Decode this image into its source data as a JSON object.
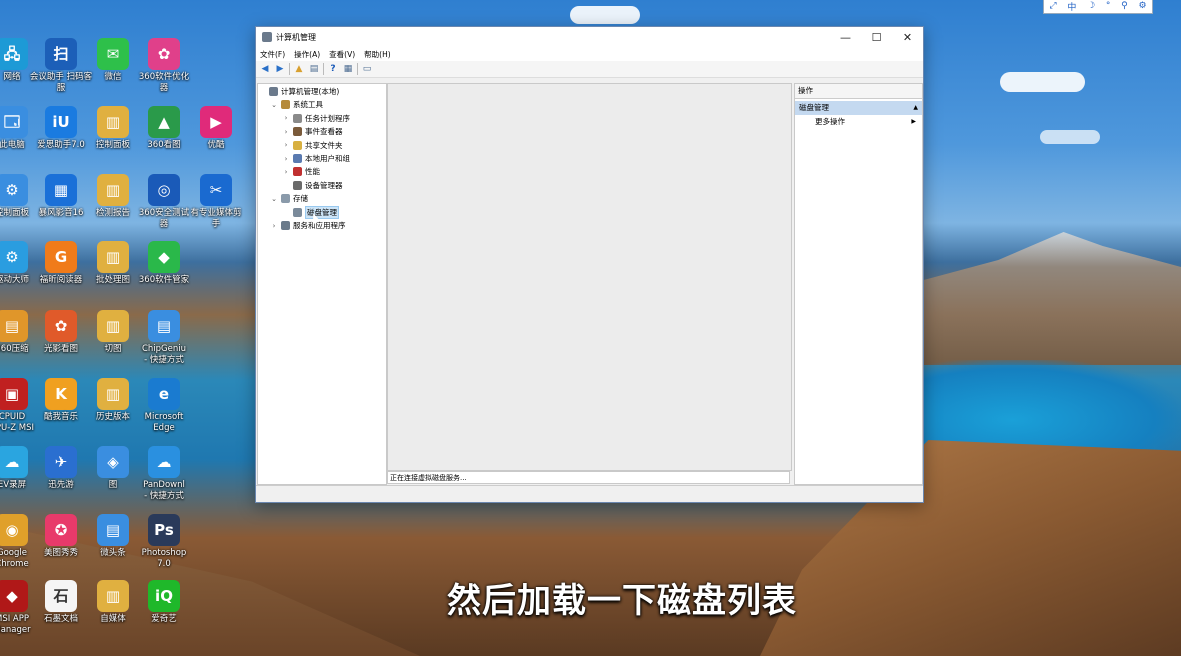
{
  "desktop": {
    "icons": [
      {
        "label": "网络",
        "color": "#1d9ad6",
        "glyph": "🖧"
      },
      {
        "label": "此电脑",
        "color": "#3a8ee0",
        "glyph": "🗔"
      },
      {
        "label": "控制面板",
        "color": "#3a8ee0",
        "glyph": "⚙"
      },
      {
        "label": "驱动大师",
        "color": "#2a9de0",
        "glyph": "⚙"
      },
      {
        "label": "360压缩",
        "color": "#e0962a",
        "glyph": "▤"
      },
      {
        "label": "CPUID\nCPU-Z MSI",
        "color": "#c02020",
        "glyph": "▣"
      },
      {
        "label": "EV录屏",
        "color": "#2aa5e0",
        "glyph": "☁"
      },
      {
        "label": "Google\nChrome",
        "color": "#e0a02a",
        "glyph": "◉"
      },
      {
        "label": "MSI APP\nManager",
        "color": "#b01818",
        "glyph": "◆"
      },
      {
        "label": "会议助手 扫码客\n服",
        "color": "#1c5fb8",
        "glyph": "扫"
      },
      {
        "label": "爱思助手7.0",
        "color": "#1a7be0",
        "glyph": "iU"
      },
      {
        "label": "暴风影音16",
        "color": "#1a70d8",
        "glyph": "▦"
      },
      {
        "label": "福昕阅读器",
        "color": "#f07b1a",
        "glyph": "G"
      },
      {
        "label": "光影看图",
        "color": "#e05a2a",
        "glyph": "✿"
      },
      {
        "label": "酷我音乐",
        "color": "#f0a020",
        "glyph": "K"
      },
      {
        "label": "迅先游",
        "color": "#2a6fd0",
        "glyph": "✈"
      },
      {
        "label": "美图秀秀",
        "color": "#e83a6a",
        "glyph": "✪"
      },
      {
        "label": "石墨文档",
        "color": "#f5f5f5",
        "glyph": "石"
      },
      {
        "label": "微信",
        "color": "#2ec04a",
        "glyph": "✉"
      },
      {
        "label": "控制面板",
        "color": "#e0b040",
        "glyph": "▥"
      },
      {
        "label": "检测报告",
        "color": "#e0b040",
        "glyph": "▥"
      },
      {
        "label": "批处理图",
        "color": "#e0b040",
        "glyph": "▥"
      },
      {
        "label": "切图",
        "color": "#e0b040",
        "glyph": "▥"
      },
      {
        "label": "历史版本",
        "color": "#e0b040",
        "glyph": "▥"
      },
      {
        "label": "图",
        "color": "#3a8ee0",
        "glyph": "◈"
      },
      {
        "label": "微头条",
        "color": "#3a8ee0",
        "glyph": "▤"
      },
      {
        "label": "自媒体",
        "color": "#e0b040",
        "glyph": "▥"
      },
      {
        "label": "360软件优化\n器",
        "color": "#e0408a",
        "glyph": "✿"
      },
      {
        "label": "360看图",
        "color": "#2a9a4a",
        "glyph": "▲"
      },
      {
        "label": "360安全测试\n器",
        "color": "#1a5ab8",
        "glyph": "◎"
      },
      {
        "label": "360软件管家",
        "color": "#2ab84a",
        "glyph": "◆"
      },
      {
        "label": "ChipGeniu\n- 快捷方式",
        "color": "#3a8ee0",
        "glyph": "▤"
      },
      {
        "label": "Microsoft\nEdge",
        "color": "#1a7bd0",
        "glyph": "e"
      },
      {
        "label": "PanDownl\n- 快捷方式",
        "color": "#2a90e0",
        "glyph": "☁"
      },
      {
        "label": "Photoshop\n7.0",
        "color": "#2a3a5a",
        "glyph": "Ps"
      },
      {
        "label": "爱奇艺",
        "color": "#1fb82a",
        "glyph": "iQ"
      },
      {
        "label": "优酷",
        "color": "#e02a7a",
        "glyph": "▶"
      },
      {
        "label": "有专业媒体剪\n手",
        "color": "#1a6ad0",
        "glyph": "✂"
      }
    ]
  },
  "tray": {
    "items": [
      "⤢",
      "中",
      "☽",
      "°",
      "⚲",
      "⚙"
    ]
  },
  "window": {
    "title": "计算机管理",
    "menu": [
      "文件(F)",
      "操作(A)",
      "查看(V)",
      "帮助(H)"
    ],
    "toolbar_icons": [
      "back-icon",
      "forward-icon",
      "up-folder-icon",
      "show-hide-tree-icon",
      "help-icon",
      "properties-icon",
      "console-icon"
    ],
    "tree": [
      {
        "label": "计算机管理(本地)",
        "level": 0,
        "expander": "",
        "color": "#6b7a8c"
      },
      {
        "label": "系统工具",
        "level": 1,
        "expander": "⌄",
        "color": "#b58a3a"
      },
      {
        "label": "任务计划程序",
        "level": 2,
        "expander": "›",
        "color": "#8a8a8a"
      },
      {
        "label": "事件查看器",
        "level": 2,
        "expander": "›",
        "color": "#7a5a3a"
      },
      {
        "label": "共享文件夹",
        "level": 2,
        "expander": "›",
        "color": "#d8b040"
      },
      {
        "label": "本地用户和组",
        "level": 2,
        "expander": "›",
        "color": "#5a7ab0"
      },
      {
        "label": "性能",
        "level": 2,
        "expander": "›",
        "color": "#c03030"
      },
      {
        "label": "设备管理器",
        "level": 2,
        "expander": "",
        "color": "#6a6a6a"
      },
      {
        "label": "存储",
        "level": 1,
        "expander": "⌄",
        "color": "#8a9aaa"
      },
      {
        "label": "磁盘管理",
        "level": 2,
        "expander": "",
        "color": "#7a8a9a",
        "selected": true
      },
      {
        "label": "服务和应用程序",
        "level": 1,
        "expander": "›",
        "color": "#6a7a8a"
      }
    ],
    "center_status": "正在连接虚拟磁盘服务...",
    "actions": {
      "header": "操作",
      "section": "磁盘管理",
      "section_arrow": "▲",
      "item": "更多操作",
      "item_arrow": "▶"
    },
    "buttons": {
      "minimize": "—",
      "maximize": "☐",
      "close": "✕"
    }
  },
  "subtitle": "然后加载一下磁盘列表"
}
